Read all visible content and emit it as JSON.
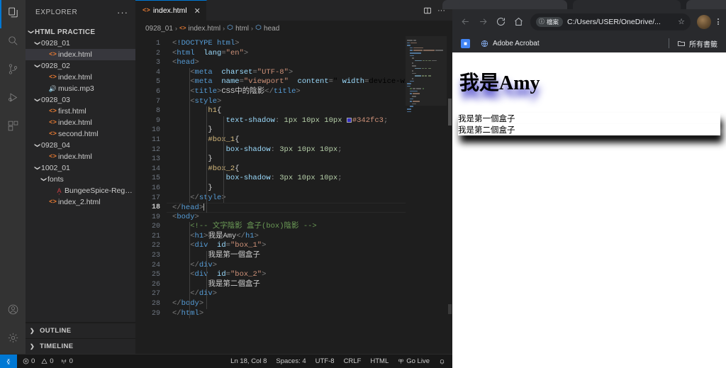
{
  "vscode": {
    "activitybar": {
      "items": [
        {
          "name": "explorer",
          "icon": "files-icon",
          "active": true
        },
        {
          "name": "search",
          "icon": "search-icon",
          "active": false
        },
        {
          "name": "source-control",
          "icon": "source-control-icon",
          "active": false
        },
        {
          "name": "run-debug",
          "icon": "run-and-debug-icon",
          "active": false
        },
        {
          "name": "extensions",
          "icon": "extensions-icon",
          "active": false
        }
      ],
      "bottom": [
        {
          "name": "accounts",
          "icon": "account-icon"
        },
        {
          "name": "manage",
          "icon": "gear-icon"
        }
      ]
    },
    "sidebar": {
      "title": "EXPLORER",
      "more_actions": "···",
      "tree": [
        {
          "label": "HTML PRACTICE",
          "type": "root",
          "depth": 0,
          "expanded": true,
          "selected": false
        },
        {
          "label": "0928_01",
          "type": "folder",
          "depth": 1,
          "expanded": true,
          "selected": false
        },
        {
          "label": "index.html",
          "type": "html",
          "depth": 2,
          "selected": true
        },
        {
          "label": "0928_02",
          "type": "folder",
          "depth": 1,
          "expanded": true,
          "selected": false
        },
        {
          "label": "index.html",
          "type": "html",
          "depth": 2,
          "selected": false
        },
        {
          "label": "music.mp3",
          "type": "audio",
          "depth": 2,
          "selected": false
        },
        {
          "label": "0928_03",
          "type": "folder",
          "depth": 1,
          "expanded": true,
          "selected": false
        },
        {
          "label": "first.html",
          "type": "html",
          "depth": 2,
          "selected": false
        },
        {
          "label": "index.html",
          "type": "html",
          "depth": 2,
          "selected": false
        },
        {
          "label": "second.html",
          "type": "html",
          "depth": 2,
          "selected": false
        },
        {
          "label": "0928_04",
          "type": "folder",
          "depth": 1,
          "expanded": true,
          "selected": false
        },
        {
          "label": "index.html",
          "type": "html",
          "depth": 2,
          "selected": false
        },
        {
          "label": "1002_01",
          "type": "folder",
          "depth": 1,
          "expanded": true,
          "selected": false
        },
        {
          "label": "fonts",
          "type": "folder",
          "depth": 2,
          "expanded": true,
          "selected": false
        },
        {
          "label": "BungeeSpice-Regu...",
          "type": "font",
          "depth": 3,
          "selected": false
        },
        {
          "label": "index_2.html",
          "type": "html",
          "depth": 2,
          "selected": false
        }
      ],
      "panels": [
        {
          "label": "OUTLINE",
          "expanded": false
        },
        {
          "label": "TIMELINE",
          "expanded": false
        }
      ]
    },
    "editor": {
      "tab": {
        "label": "index.html",
        "icon": "html5-icon",
        "close": "✕"
      },
      "tab_actions": [
        {
          "name": "split-editor-right-icon",
          "glyph": "split"
        },
        {
          "name": "more-actions-icon",
          "glyph": "···"
        }
      ],
      "breadcrumbs": [
        {
          "label": "0928_01",
          "icon": null
        },
        {
          "label": "index.html",
          "icon": "html5-icon"
        },
        {
          "label": "html",
          "icon": "tag-icon"
        },
        {
          "label": "head",
          "icon": "tag-icon"
        }
      ],
      "separator": "›",
      "cursor_line": 18,
      "total_lines": 29,
      "code_color_swatch": "#342fc3",
      "lines": [
        {
          "n": 1,
          "text": "<!DOCTYPE html>"
        },
        {
          "n": 2,
          "text": "<html lang=\"en\">"
        },
        {
          "n": 3,
          "text": "<head>"
        },
        {
          "n": 4,
          "text": "    <meta charset=\"UTF-8\">"
        },
        {
          "n": 5,
          "text": "    <meta name=\"viewport\" content=\"width=device-width, initial-scale"
        },
        {
          "n": 6,
          "text": "    <title>CSS中的陰影</title>"
        },
        {
          "n": 7,
          "text": "    <style>"
        },
        {
          "n": 8,
          "text": "        h1{"
        },
        {
          "n": 9,
          "text": "            text-shadow: 1px 10px 10px #342fc3;"
        },
        {
          "n": 10,
          "text": "        }"
        },
        {
          "n": 11,
          "text": "        #box_1{"
        },
        {
          "n": 12,
          "text": "            box-shadow: 3px 10px 10px;"
        },
        {
          "n": 13,
          "text": "        }"
        },
        {
          "n": 14,
          "text": "        #box_2{"
        },
        {
          "n": 15,
          "text": "            box-shadow: 3px 10px 10px;"
        },
        {
          "n": 16,
          "text": "        }"
        },
        {
          "n": 17,
          "text": "    </style>"
        },
        {
          "n": 18,
          "text": "</head>"
        },
        {
          "n": 19,
          "text": "<body>"
        },
        {
          "n": 20,
          "text": "    <!-- 文字陰影 盒子(box)陰影 -->"
        },
        {
          "n": 21,
          "text": "    <h1>我是Amy</h1>"
        },
        {
          "n": 22,
          "text": "    <div id=\"box_1\">"
        },
        {
          "n": 23,
          "text": "        我是第一個盒子"
        },
        {
          "n": 24,
          "text": "    </div>"
        },
        {
          "n": 25,
          "text": "    <div id=\"box_2\">"
        },
        {
          "n": 26,
          "text": "        我是第二個盒子"
        },
        {
          "n": 27,
          "text": "    </div>"
        },
        {
          "n": 28,
          "text": "</body>"
        },
        {
          "n": 29,
          "text": "</html>"
        }
      ]
    },
    "statusbar": {
      "remote_label": "",
      "left": [
        {
          "name": "problems",
          "icon": "error-icon",
          "label": "0"
        },
        {
          "name": "warnings",
          "icon": "warning-icon",
          "label": "0"
        },
        {
          "name": "ports",
          "icon": "radio-tower-icon",
          "label": "0"
        }
      ],
      "right": [
        {
          "name": "cursor-position",
          "label": "Ln 18, Col 8"
        },
        {
          "name": "indentation",
          "label": "Spaces: 4"
        },
        {
          "name": "encoding",
          "label": "UTF-8"
        },
        {
          "name": "eol",
          "label": "CRLF"
        },
        {
          "name": "language-mode",
          "label": "HTML"
        },
        {
          "name": "go-live",
          "label": "Go Live",
          "icon": "broadcast-icon"
        },
        {
          "name": "notifications",
          "label": "",
          "icon": "bell-icon"
        }
      ]
    }
  },
  "browser": {
    "nav": {
      "back": "←",
      "forward": "→",
      "reload": "↻",
      "home": "⌂"
    },
    "omnibox": {
      "chip_label": "檔案",
      "chip_icon": "info-circle-icon",
      "url": "C:/Users/USER/OneDrive/...",
      "star": "☆"
    },
    "bookmarks": {
      "items": [
        {
          "label": "",
          "favicon": "google-docs-icon",
          "color": "#4285f4"
        },
        {
          "label": "Adobe Acrobat",
          "favicon": "globe-icon",
          "color": "#8ab4f8"
        }
      ],
      "all_bookmarks": "所有書籤",
      "all_bookmarks_icon": "folder-icon"
    },
    "page": {
      "heading": "我是Amy",
      "box1": "我是第一個盒子",
      "box2": "我是第二個盒子",
      "heading_shadow_color": "#342fc3"
    }
  }
}
